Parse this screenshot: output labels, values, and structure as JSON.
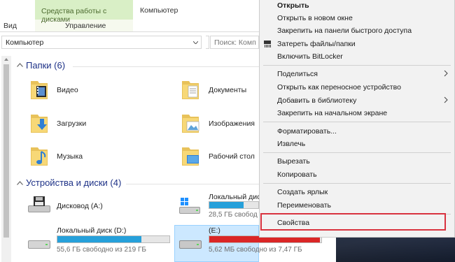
{
  "ribbon": {
    "tabs": [
      "Вид",
      "Компьютер"
    ],
    "contextual_group": "Средства работы с дисками",
    "manage_label": "Управление"
  },
  "address": {
    "path": "Компьютер",
    "search_placeholder": "Поиск: Комп"
  },
  "folders_section": {
    "title": "Папки (6)"
  },
  "folders": [
    {
      "label": "Видео"
    },
    {
      "label": "Документы"
    },
    {
      "label": "Загрузки"
    },
    {
      "label": "Изображения"
    },
    {
      "label": "Музыка"
    },
    {
      "label": "Рабочий стол"
    }
  ],
  "devices_section": {
    "title": "Устройства и диски (4)"
  },
  "drives": [
    {
      "label": "Дисковод (A:)",
      "size": ""
    },
    {
      "label": "Локальный дис",
      "size": "28,5 ГБ свобод",
      "used_fraction": 0.7,
      "color": "#26a0da"
    },
    {
      "label": "Локальный диск (D:)",
      "size": "55,6 ГБ свободно из 219 ГБ",
      "used_fraction": 0.75,
      "color": "#26a0da"
    },
    {
      "label": "(E:)",
      "size": "5,62 МБ свободно из 7,47 ГБ",
      "used_fraction": 0.99,
      "color": "#da2626"
    }
  ],
  "context_menu": {
    "items": [
      "Открыть",
      "Открыть в новом окне",
      "Закрепить на панели быстрого доступа",
      "Затереть файлы/папки",
      "Включить BitLocker",
      "Поделиться",
      "Открыть как переносное устройство",
      "Добавить в библиотеку",
      "Закрепить на начальном экране",
      "Форматировать...",
      "Извлечь",
      "Вырезать",
      "Копировать",
      "Создать ярлык",
      "Переименовать",
      "Свойства"
    ]
  },
  "colors": {
    "accent": "#26a0da",
    "danger": "#da2626",
    "highlight_border": "#d9333f",
    "section_title": "#1e3287"
  }
}
